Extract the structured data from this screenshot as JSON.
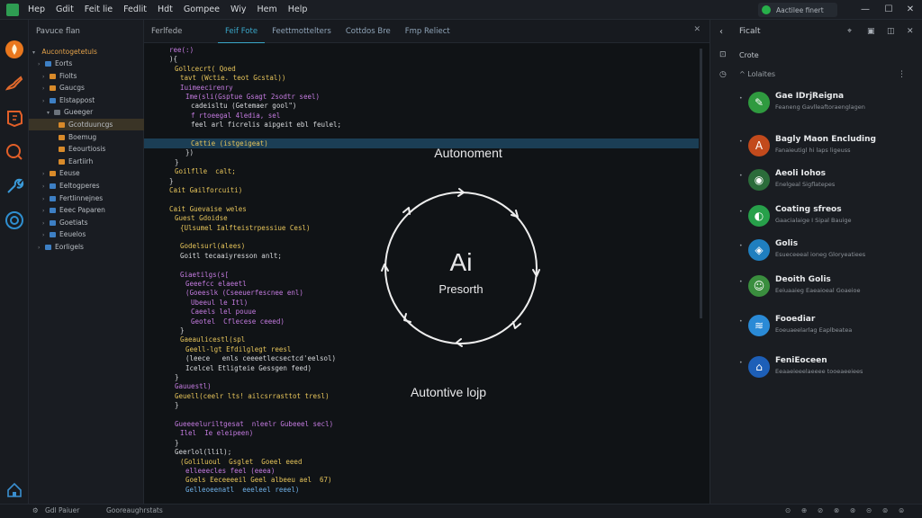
{
  "menu": [
    "Hep",
    "Gdit",
    "Feit lie",
    "Fedlit",
    "Hdt",
    "Gompee",
    "Wiy",
    "Hem",
    "Help"
  ],
  "account": {
    "label": "Aactilee finert",
    "status_color": "#27b04a"
  },
  "window_controls": {
    "min": "—",
    "max": "☐",
    "close": "✕"
  },
  "activity_icons": [
    "flame-icon",
    "brush-icon",
    "badge-icon",
    "search-icon",
    "wrench-icon",
    "target-icon",
    "home-icon"
  ],
  "explorer": {
    "header": "Pavuce flan",
    "root": "Aucontogetetuls",
    "items": [
      {
        "label": "Eorts",
        "icon": "blue",
        "indent": 2,
        "twisty": "›"
      },
      {
        "label": "Fiolts",
        "icon": "orange",
        "indent": 3,
        "twisty": "›"
      },
      {
        "label": "Gaucgs",
        "icon": "orange",
        "indent": 3,
        "twisty": "›"
      },
      {
        "label": "Elstappost",
        "icon": "blue",
        "indent": 3,
        "twisty": "›"
      },
      {
        "label": "Gueeger",
        "icon": "gray",
        "indent": 4,
        "twisty": "▾"
      },
      {
        "label": "Gcotduuncgs",
        "icon": "orange",
        "indent": 5,
        "twisty": "",
        "selected": true
      },
      {
        "label": "Boemug",
        "icon": "orange",
        "indent": 5,
        "twisty": ""
      },
      {
        "label": "Eeourtiosis",
        "icon": "orange",
        "indent": 5,
        "twisty": ""
      },
      {
        "label": "Eartiirh",
        "icon": "orange",
        "indent": 5,
        "twisty": ""
      },
      {
        "label": "Eeuse",
        "icon": "orange",
        "indent": 3,
        "twisty": "›"
      },
      {
        "label": "Eeltogperes",
        "icon": "blue",
        "indent": 3,
        "twisty": "›"
      },
      {
        "label": "Fertlinnejnes",
        "icon": "blue",
        "indent": 3,
        "twisty": "›"
      },
      {
        "label": "Eeec Paparen",
        "icon": "blue",
        "indent": 3,
        "twisty": "›"
      },
      {
        "label": "Goetiats",
        "icon": "blue",
        "indent": 3,
        "twisty": "›"
      },
      {
        "label": "Eeuelos",
        "icon": "blue",
        "indent": 3,
        "twisty": "›"
      },
      {
        "label": "Eorligels",
        "icon": "blue",
        "indent": 2,
        "twisty": "›"
      }
    ]
  },
  "tabs": [
    "Ferlfede",
    "Feif Fote",
    "Feettmottelters",
    "Cottdos Bre",
    "Fmp Reliect"
  ],
  "tabs_active_index": 1,
  "code_lines": [
    {
      "indent": 2,
      "text": "ree(:)",
      "color": "c-p"
    },
    {
      "indent": 2,
      "text": "){",
      "color": "c-w"
    },
    {
      "indent": 3,
      "text": "Gollcecrt( Qoed",
      "color": "c-y"
    },
    {
      "indent": 4,
      "text": "tavt (Wctie. teot Gcstal))",
      "color": "c-y"
    },
    {
      "indent": 4,
      "text": "Iuimeecirenry",
      "color": "c-p"
    },
    {
      "indent": 5,
      "text": "Ime(sli(Gsptue Gsagt 2sodtr seel)",
      "color": "c-p"
    },
    {
      "indent": 6,
      "text": "cadeisltu (Getemaer gool\")",
      "color": "c-w"
    },
    {
      "indent": 6,
      "text": "f rtoeegal 4ledia, sel",
      "color": "c-p"
    },
    {
      "indent": 6,
      "text": "feel arl ficrelis aipgeit ebl feulel;",
      "color": "c-w"
    },
    {
      "indent": 5,
      "text": "",
      "color": "c-w"
    },
    {
      "indent": 6,
      "text": "Cattie (istgeigeat)",
      "color": "c-y"
    },
    {
      "indent": 5,
      "text": "})",
      "color": "c-w"
    },
    {
      "indent": 3,
      "text": "}",
      "color": "c-w"
    },
    {
      "indent": 3,
      "text": "Goilflle  calt;",
      "color": "c-y"
    },
    {
      "indent": 2,
      "text": "}",
      "color": "c-w"
    },
    {
      "indent": 2,
      "text": "Cait Gailforcuiti)",
      "color": "c-y"
    },
    {
      "indent": 2,
      "text": "",
      "color": "c-w"
    },
    {
      "indent": 2,
      "text": "Cait Guevaise weles",
      "color": "c-y"
    },
    {
      "indent": 3,
      "text": "Guest Gdoidse",
      "color": "c-y"
    },
    {
      "indent": 4,
      "text": "{Ulsumel Ialfteistrpessiue Cesl)",
      "color": "c-y"
    },
    {
      "indent": 3,
      "text": "",
      "color": "c-w"
    },
    {
      "indent": 4,
      "text": "Godelsurl(alees)",
      "color": "c-y"
    },
    {
      "indent": 4,
      "text": "Goitl tecaaiyresson anlt;",
      "color": "c-w"
    },
    {
      "indent": 3,
      "text": "",
      "color": "c-w"
    },
    {
      "indent": 4,
      "text": "Giaetilgs(s[",
      "color": "c-p"
    },
    {
      "indent": 5,
      "text": "Geeefcc elaeetl",
      "color": "c-p"
    },
    {
      "indent": 5,
      "text": "(Goeeslk (Cseeuerfescnee enl)",
      "color": "c-p"
    },
    {
      "indent": 6,
      "text": "Ubeeul le Itl)",
      "color": "c-p"
    },
    {
      "indent": 6,
      "text": "Caeels lel pouue",
      "color": "c-p"
    },
    {
      "indent": 6,
      "text": "Geotel  Cflecese ceeed)",
      "color": "c-p"
    },
    {
      "indent": 4,
      "text": "}",
      "color": "c-w"
    },
    {
      "indent": 4,
      "text": "Gaeaulicestl(spl",
      "color": "c-y"
    },
    {
      "indent": 5,
      "text": "Geell-lgt Efdilglegt reesl",
      "color": "c-y"
    },
    {
      "indent": 5,
      "text": "(leece   enls ceeeetlecsectcd'eelsol)",
      "color": "c-w"
    },
    {
      "indent": 5,
      "text": "Icelcel Etligteie Gessgen feed)",
      "color": "c-w"
    },
    {
      "indent": 3,
      "text": "}",
      "color": "c-w"
    },
    {
      "indent": 3,
      "text": "Gauuestl)",
      "color": "c-p"
    },
    {
      "indent": 3,
      "text": "Geuell(ceelr lts! ailcsrrasttot tresl)",
      "color": "c-y"
    },
    {
      "indent": 3,
      "text": "}",
      "color": "c-w"
    },
    {
      "indent": 2,
      "text": "",
      "color": "c-w"
    },
    {
      "indent": 3,
      "text": "Gueeeeluriltgesat  nleelr Gubeeel secl)",
      "color": "c-p"
    },
    {
      "indent": 4,
      "text": "Ilel  Ie eleipeen)",
      "color": "c-p"
    },
    {
      "indent": 3,
      "text": "}",
      "color": "c-w"
    },
    {
      "indent": 3,
      "text": "Geerlol(llil);",
      "color": "c-w"
    },
    {
      "indent": 4,
      "text": "(Goliluoul  Gsglet  Goeel eeed",
      "color": "c-y"
    },
    {
      "indent": 5,
      "text": "elleeecles feel (eeea)",
      "color": "c-p"
    },
    {
      "indent": 5,
      "text": "Goels Eeceeeeil Geel albeeu ael  67)",
      "color": "c-y"
    },
    {
      "indent": 5,
      "text": "Gelleoeenatl  eeeleel reeel)",
      "color": "c-b"
    }
  ],
  "diagram": {
    "top_label": "Autonoment",
    "center_title": "Ai",
    "center_subtitle": "Presorth",
    "bottom_label": "Autontive lojp"
  },
  "right_panel": {
    "title": "Ficalt",
    "subheader": "Crote",
    "group": "Lolaites",
    "items": [
      {
        "title": "Gae IDrjReigna",
        "sub": "Feaneng Gavlleaftoraenglagen",
        "color": "#2f9a3f",
        "glyph": "✎"
      },
      {
        "title": "Bagly Maon Encluding",
        "sub": "Fanaieutigl hi laps ligeuss",
        "color": "#c24a1c",
        "glyph": "A"
      },
      {
        "title": "Aeoli Iohos",
        "sub": "Enelgeal Sigflatepes",
        "color": "#2b6c3a",
        "glyph": "◉"
      },
      {
        "title": "Coating sfreos",
        "sub": "Gaacialaige I Sipal Bauige",
        "color": "#27a04a",
        "glyph": "◐"
      },
      {
        "title": "Golis",
        "sub": "Esueceeeal ioneg Gloryeatiees",
        "color": "#1f7fbf",
        "glyph": "◈"
      },
      {
        "title": "Deoith Golis",
        "sub": "Eeiuaaieg Eaeaioeal Goaeioe",
        "color": "#3a8e3e",
        "glyph": "☺"
      },
      {
        "title": "Fooediar",
        "sub": "Eoeuaeelarlag Eaplbeatea",
        "color": "#2a8ad6",
        "glyph": "≋"
      },
      {
        "title": "FeniEoceen",
        "sub": "Eeaaeieeelaeeee tooeaeeiees",
        "color": "#1d5fb8",
        "glyph": "⌂"
      }
    ]
  },
  "status": {
    "left": "Gdl Paiuer",
    "branch": "Gooreaughrstats",
    "right_icons": [
      "⊙",
      "⊕",
      "⊘",
      "⊗",
      "⊛",
      "⊝",
      "⊚",
      "⊜"
    ]
  }
}
